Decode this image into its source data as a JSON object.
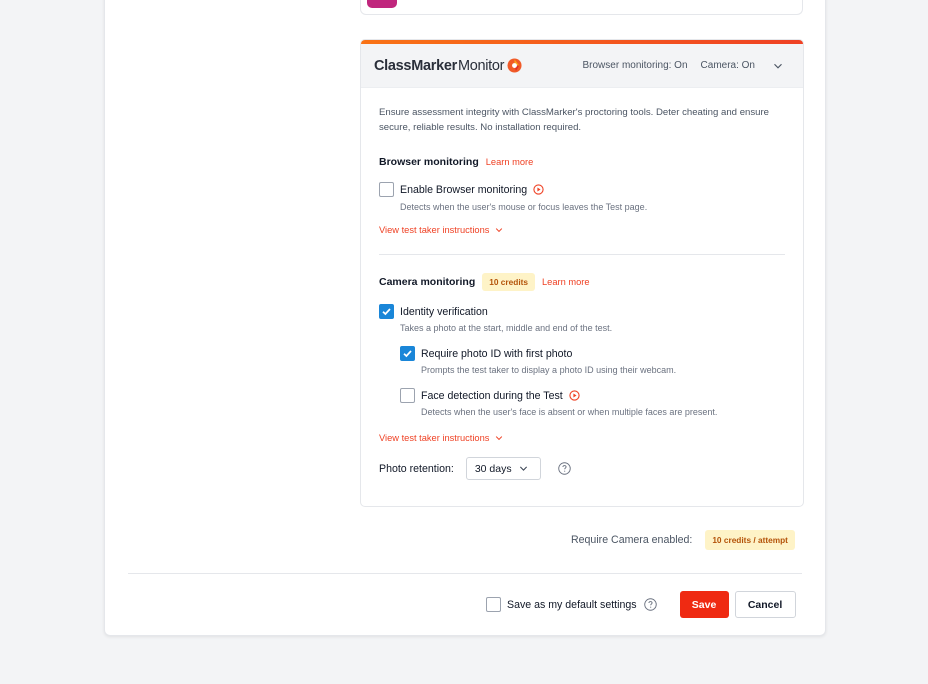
{
  "monitor": {
    "brand_bold": "ClassMarker",
    "brand_light": "Monitor",
    "browser_status": "Browser monitoring: On",
    "camera_status": "Camera: On",
    "intro": "Ensure assessment integrity with ClassMarker's proctoring tools. Deter cheating and ensure secure, reliable results. No installation required.",
    "browser": {
      "title": "Browser monitoring",
      "learn_more": "Learn more",
      "enable_label": "Enable Browser monitoring",
      "enable_checked": false,
      "enable_help": "Detects when the user's mouse or focus leaves the Test page.",
      "instructions_link": "View test taker instructions"
    },
    "camera": {
      "title": "Camera monitoring",
      "credits": "10 credits",
      "learn_more": "Learn more",
      "identity_label": "Identity verification",
      "identity_checked": true,
      "identity_help": "Takes a photo at the start, middle and end of the test.",
      "photo_id_label": "Require photo ID with first photo",
      "photo_id_checked": true,
      "photo_id_help": "Prompts the test taker to display a photo ID using their webcam.",
      "face_label": "Face detection during the Test",
      "face_checked": false,
      "face_help": "Detects when the user's face is absent or when multiple faces are present.",
      "instructions_link": "View test taker instructions",
      "retention_label": "Photo retention:",
      "retention_value": "30 days"
    }
  },
  "require_camera": {
    "label": "Require Camera enabled:",
    "credits": "10 credits / attempt"
  },
  "footer": {
    "default_label": "Save as my default settings",
    "default_checked": false,
    "save_label": "Save",
    "cancel_label": "Cancel"
  },
  "colors": {
    "accent": "#ef4124",
    "save_button": "#ef2a12",
    "checkbox_checked": "#1a86d8",
    "credits_bg": "#fef3c7",
    "credits_text": "#b45309"
  }
}
